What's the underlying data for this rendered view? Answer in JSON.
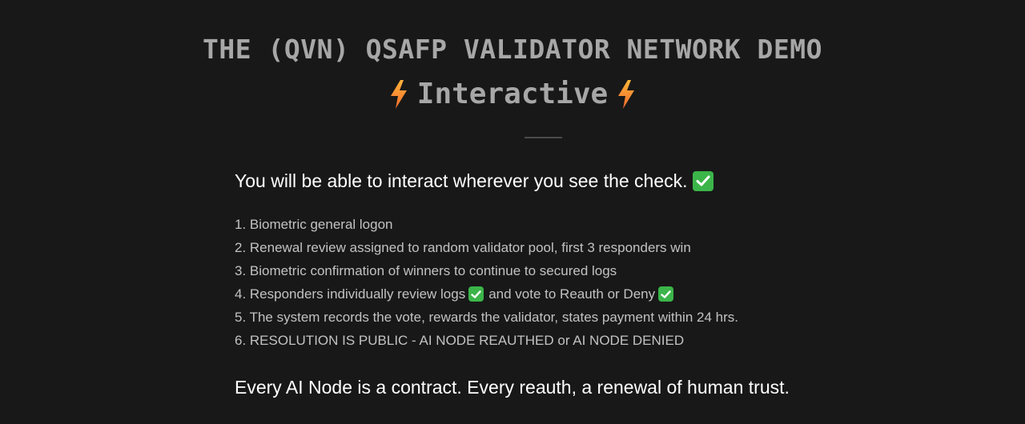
{
  "header": {
    "title": "THE (QVN) QSAFP VALIDATOR NETWORK DEMO",
    "subtitle": "Interactive",
    "subtitle_icon": "lightning-bolt-icon"
  },
  "intro": {
    "text": "You will be able to interact wherever you see the check.",
    "icon": "check-mark-icon"
  },
  "steps": [
    {
      "text": "1. Biometric general logon"
    },
    {
      "text": "2. Renewal review assigned to random validator pool, first 3 responders win"
    },
    {
      "text": "3. Biometric confirmation of winners to continue to secured logs"
    },
    {
      "text_a": "4. Responders individually review logs",
      "text_b": "and vote to Reauth or Deny"
    },
    {
      "text": "5. The system records the vote, rewards the validator, states payment within 24 hrs."
    },
    {
      "text": "6. RESOLUTION IS PUBLIC - AI NODE REAUTHED or AI NODE DENIED"
    }
  ],
  "closing": {
    "text": "Every AI Node is a contract. Every reauth, a renewal of human trust."
  },
  "colors": {
    "background": "#181818",
    "title": "#a7a7a7",
    "check": "#3bb54a",
    "bolt_top": "#ffb43a",
    "bolt_bottom": "#f26a2b"
  }
}
